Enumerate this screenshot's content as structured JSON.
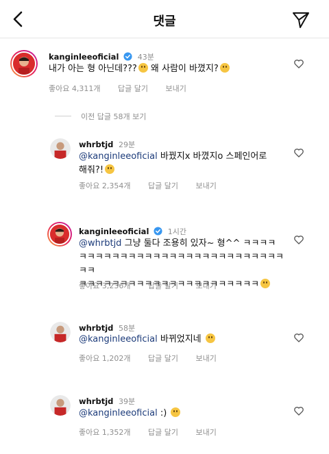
{
  "header": {
    "title": "댓글",
    "back_icon": "back-chevron-icon",
    "send_icon": "paper-plane-icon"
  },
  "comments": [
    {
      "username": "kanginleeoficial",
      "verified": true,
      "time": "43분",
      "text": "내가 아는 형 아닌데???",
      "text2": " 왜 사람이 바꼈지?",
      "likes": "좋아요 4,311개",
      "reply": "답글 달기",
      "send": "보내기"
    },
    {
      "username": "whrbtjd",
      "time": "29분",
      "mention": "@kanginleeoficial",
      "text": " 바꿨지x 바꼈지o 스페인어로",
      "text2": "해줘?!",
      "likes": "좋아요 2,354개",
      "reply": "답글 달기",
      "send": "보내기"
    },
    {
      "username": "kanginleeoficial",
      "verified": true,
      "time": "1시간",
      "mention": "@whrbtjd",
      "text": " 그냥 둘다 조용히 있자~ 형^^ ㅋㅋㅋㅋ",
      "text2": "ㅋㅋㅋㅋㅋㅋㅋㅋㅋㅋㅋㅋㅋㅋㅋㅋㅋㅋㅋㅋㅋㅋㅋㅋㅋㅋㅋ",
      "text3": "ㅋㅋㅋㅋㅋㅋㅋㅋㅋㅋㅋㅋㅋㅋㅋㅋㅋㅋㅋㅋㅋㅋ",
      "likes": "좋아요 3,236개",
      "reply": "답글 달기",
      "send": "보내기"
    },
    {
      "username": "whrbtjd",
      "time": "58분",
      "mention": "@kanginleeoficial",
      "text": " 바뀌었지네",
      "likes": "좋아요 1,202개",
      "reply": "답글 달기",
      "send": "보내기"
    },
    {
      "username": "whrbtjd",
      "time": "39분",
      "mention": "@kanginleeoficial",
      "text": " :)",
      "likes": "좋아요 1,352개",
      "reply": "답글 달기",
      "send": "보내기"
    }
  ],
  "more_replies": "이전 답글 58개 보기",
  "colors": {
    "mention": "#1c3b7a",
    "verified": "#3897f0",
    "muted": "#8e8e8e"
  }
}
